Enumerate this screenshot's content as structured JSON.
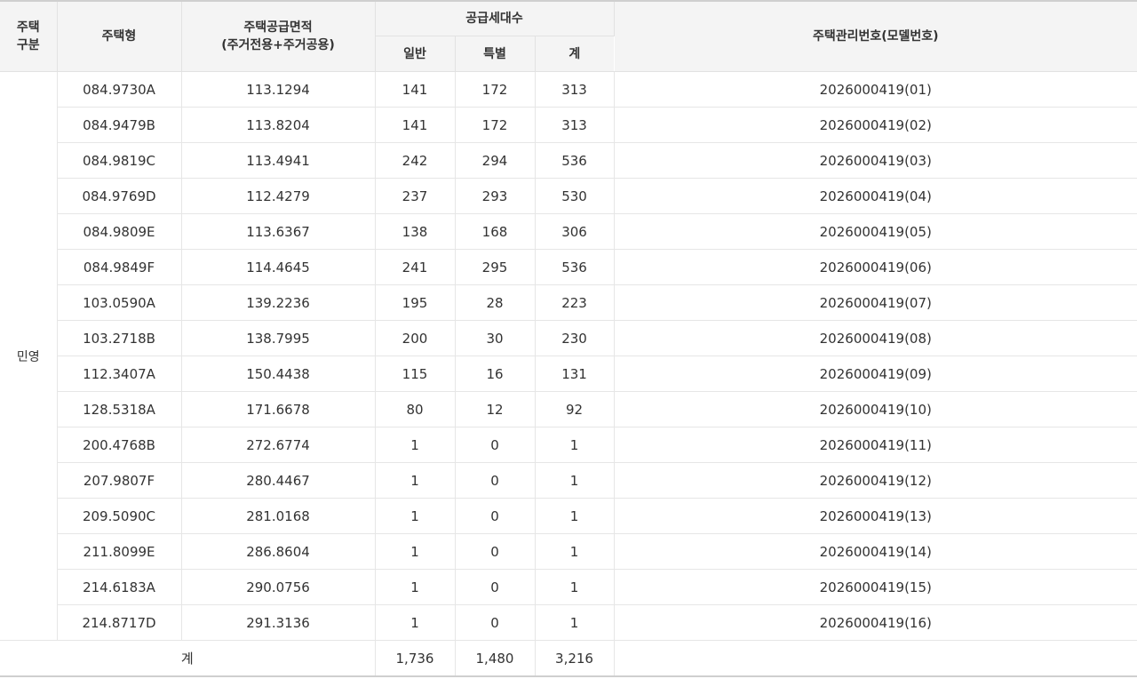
{
  "header": {
    "category_line1": "주택",
    "category_line2": "구분",
    "housing_type": "주택형",
    "supply_area_line1": "주택공급면적",
    "supply_area_line2": "(주거전용+주거공용)",
    "supply_units": "공급세대수",
    "general": "일반",
    "special": "특별",
    "total": "계",
    "management_no": "주택관리번호(모델번호)"
  },
  "category": "민영",
  "rows": [
    {
      "type": "084.9730A",
      "area": "113.1294",
      "general": "141",
      "special": "172",
      "total": "313",
      "code": "2026000419(01)"
    },
    {
      "type": "084.9479B",
      "area": "113.8204",
      "general": "141",
      "special": "172",
      "total": "313",
      "code": "2026000419(02)"
    },
    {
      "type": "084.9819C",
      "area": "113.4941",
      "general": "242",
      "special": "294",
      "total": "536",
      "code": "2026000419(03)"
    },
    {
      "type": "084.9769D",
      "area": "112.4279",
      "general": "237",
      "special": "293",
      "total": "530",
      "code": "2026000419(04)"
    },
    {
      "type": "084.9809E",
      "area": "113.6367",
      "general": "138",
      "special": "168",
      "total": "306",
      "code": "2026000419(05)"
    },
    {
      "type": "084.9849F",
      "area": "114.4645",
      "general": "241",
      "special": "295",
      "total": "536",
      "code": "2026000419(06)"
    },
    {
      "type": "103.0590A",
      "area": "139.2236",
      "general": "195",
      "special": "28",
      "total": "223",
      "code": "2026000419(07)"
    },
    {
      "type": "103.2718B",
      "area": "138.7995",
      "general": "200",
      "special": "30",
      "total": "230",
      "code": "2026000419(08)"
    },
    {
      "type": "112.3407A",
      "area": "150.4438",
      "general": "115",
      "special": "16",
      "total": "131",
      "code": "2026000419(09)"
    },
    {
      "type": "128.5318A",
      "area": "171.6678",
      "general": "80",
      "special": "12",
      "total": "92",
      "code": "2026000419(10)"
    },
    {
      "type": "200.4768B",
      "area": "272.6774",
      "general": "1",
      "special": "0",
      "total": "1",
      "code": "2026000419(11)"
    },
    {
      "type": "207.9807F",
      "area": "280.4467",
      "general": "1",
      "special": "0",
      "total": "1",
      "code": "2026000419(12)"
    },
    {
      "type": "209.5090C",
      "area": "281.0168",
      "general": "1",
      "special": "0",
      "total": "1",
      "code": "2026000419(13)"
    },
    {
      "type": "211.8099E",
      "area": "286.8604",
      "general": "1",
      "special": "0",
      "total": "1",
      "code": "2026000419(14)"
    },
    {
      "type": "214.6183A",
      "area": "290.0756",
      "general": "1",
      "special": "0",
      "total": "1",
      "code": "2026000419(15)"
    },
    {
      "type": "214.8717D",
      "area": "291.3136",
      "general": "1",
      "special": "0",
      "total": "1",
      "code": "2026000419(16)"
    }
  ],
  "totals": {
    "label": "계",
    "general": "1,736",
    "special": "1,480",
    "total": "3,216"
  }
}
